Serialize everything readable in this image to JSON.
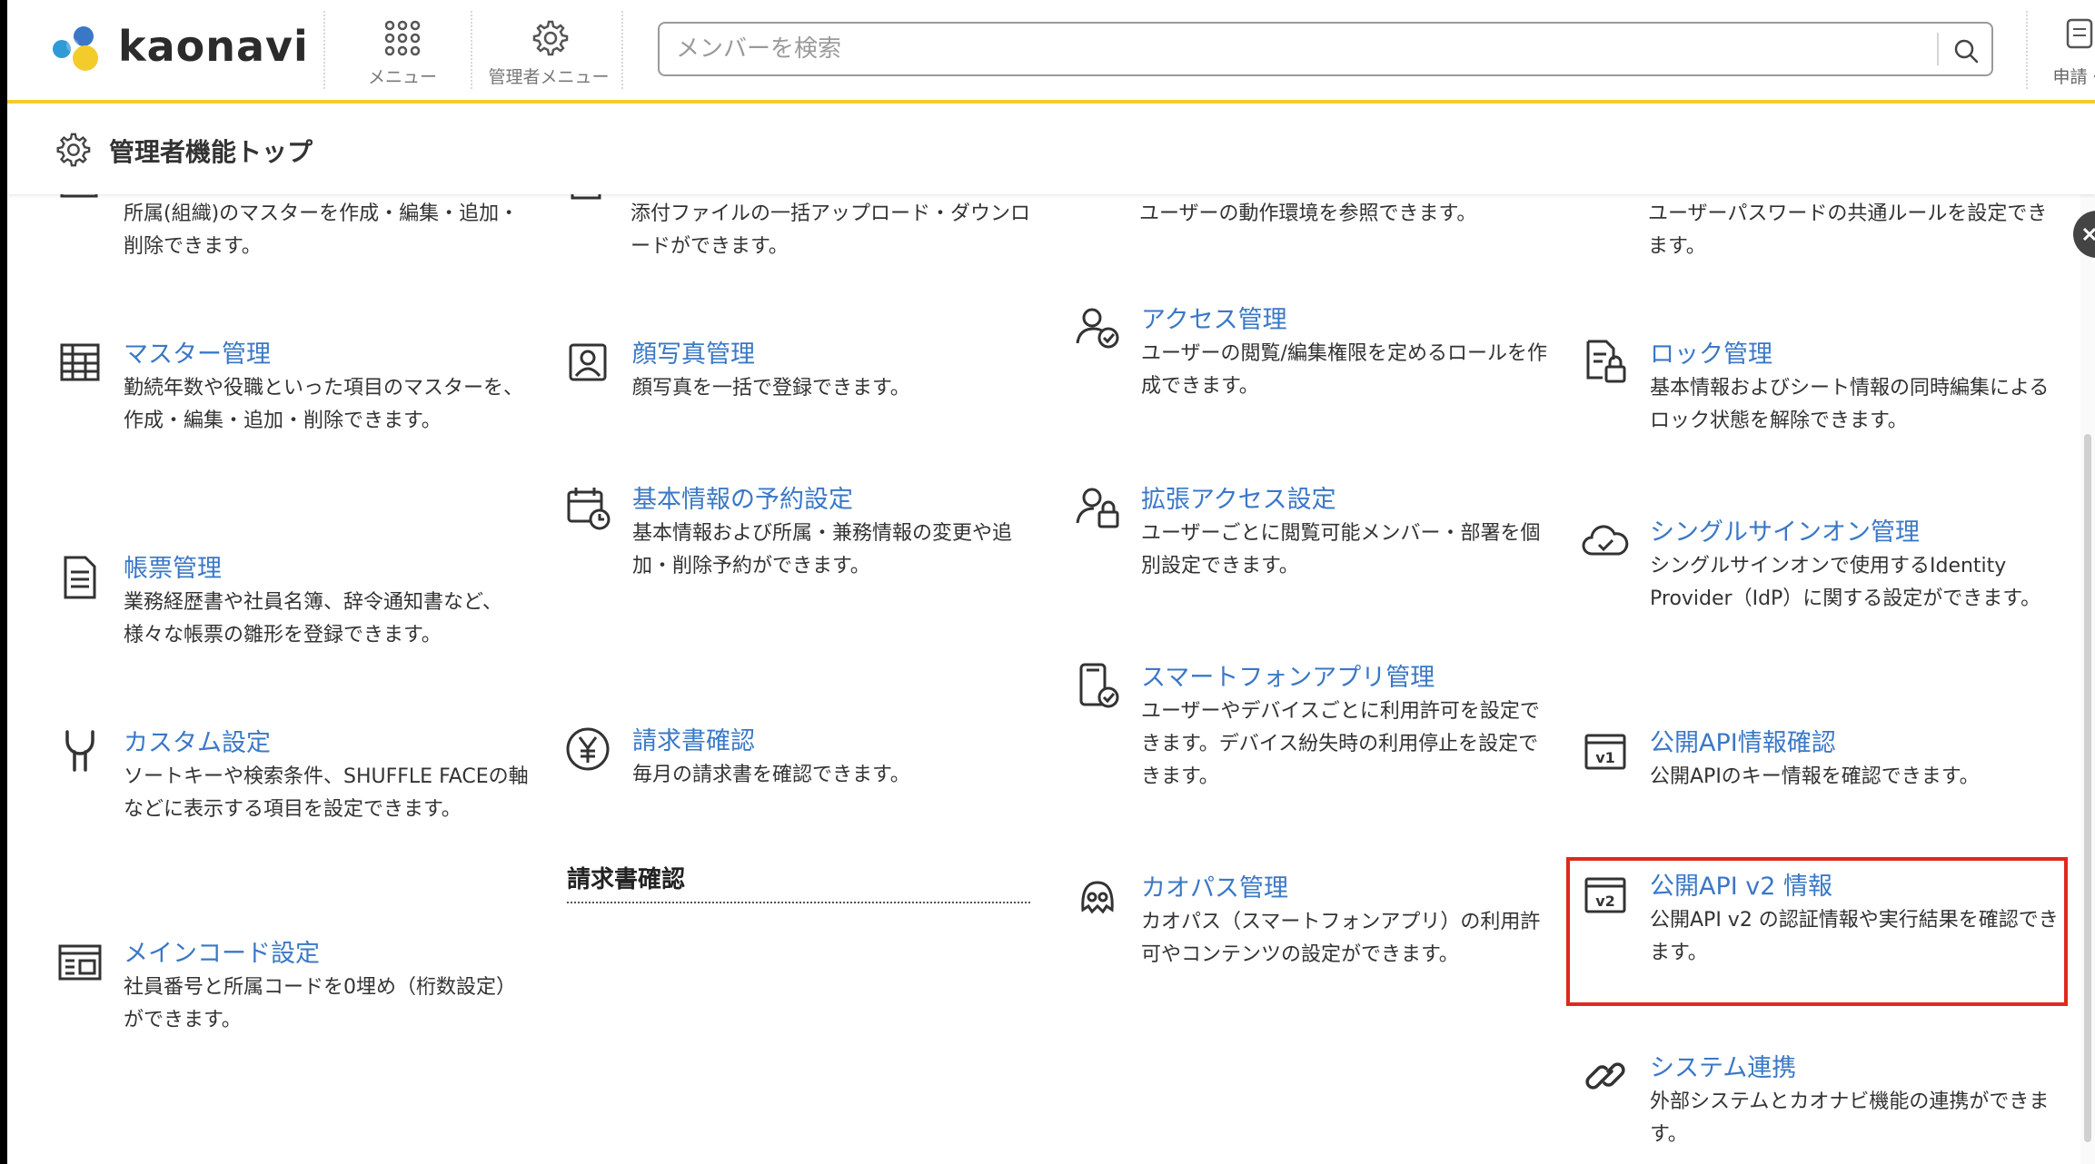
{
  "header": {
    "logo_text": "kaonavi",
    "menu_label": "メニュー",
    "admin_menu_label": "管理者メニュー",
    "search_placeholder": "メンバーを検索",
    "request_label": "申請・"
  },
  "subheader": {
    "title": "管理者機能トップ"
  },
  "colors": {
    "link": "#3a78c7",
    "accent_bar": "#f3cc2c",
    "highlight_border": "#e0281c"
  },
  "partial_items": [
    {
      "desc": "所属(組織)のマスターを作成・編集・追加・削除できます。"
    },
    {
      "desc": "添付ファイルの一括アップロード・ダウンロードができます。"
    },
    {
      "desc": "ユーザーの動作環境を参照できます。"
    },
    {
      "desc": "ユーザーパスワードの共通ルールを設定できます。"
    }
  ],
  "items": [
    {
      "key": "master",
      "icon": "table-icon",
      "title": "マスター管理",
      "desc": "勤続年数や役職といった項目のマスターを、作成・編集・追加・削除できます。"
    },
    {
      "key": "forms",
      "icon": "document-icon",
      "title": "帳票管理",
      "desc": "業務経歴書や社員名簿、辞令通知書など、様々な帳票の雛形を登録できます。"
    },
    {
      "key": "custom",
      "icon": "wrench-icon",
      "title": "カスタム設定",
      "desc": "ソートキーや検索条件、SHUFFLE FACEの軸などに表示する項目を設定できます。"
    },
    {
      "key": "maincode",
      "icon": "code-list-icon",
      "title": "メインコード設定",
      "desc": "社員番号と所属コードを0埋め（桁数設定）ができます。"
    },
    {
      "key": "photo",
      "icon": "portrait-icon",
      "title": "顔写真管理",
      "desc": "顔写真を一括で登録できます。"
    },
    {
      "key": "reserve",
      "icon": "calendar-clock-icon",
      "title": "基本情報の予約設定",
      "desc": "基本情報および所属・兼務情報の変更や追加・削除予約ができます。"
    },
    {
      "key": "invoice",
      "icon": "yen-icon",
      "title": "請求書確認",
      "desc": "毎月の請求書を確認できます。"
    },
    {
      "key": "access",
      "icon": "user-check-icon",
      "title": "アクセス管理",
      "desc": "ユーザーの閲覧/編集権限を定めるロールを作成できます。"
    },
    {
      "key": "extaccess",
      "icon": "user-lock-icon",
      "title": "拡張アクセス設定",
      "desc": "ユーザーごとに閲覧可能メンバー・部署を個別設定できます。"
    },
    {
      "key": "smartphone",
      "icon": "smartphone-check-icon",
      "title": "スマートフォンアプリ管理",
      "desc": "ユーザーやデバイスごとに利用許可を設定できます。デバイス紛失時の利用停止を設定できます。"
    },
    {
      "key": "kaopass",
      "icon": "kaopass-icon",
      "title": "カオパス管理",
      "desc": "カオパス（スマートフォンアプリ）の利用許可やコンテンツの設定ができます。"
    },
    {
      "key": "lock",
      "icon": "document-lock-icon",
      "title": "ロック管理",
      "desc": "基本情報およびシート情報の同時編集によるロック状態を解除できます。"
    },
    {
      "key": "sso",
      "icon": "cloud-check-icon",
      "title": "シングルサインオン管理",
      "desc": "シングルサインオンで使用するIdentity Provider（IdP）に関する設定ができます。"
    },
    {
      "key": "api1",
      "icon": "api-v1-icon",
      "title": "公開API情報確認",
      "desc": "公開APIのキー情報を確認できます。"
    },
    {
      "key": "api2",
      "icon": "api-v2-icon",
      "title": "公開API v2 情報",
      "desc": "公開API v2 の認証情報や実行結果を確認できます。"
    },
    {
      "key": "system",
      "icon": "link-icon",
      "title": "システム連携",
      "desc": "外部システムとカオナビ機能の連携ができます。"
    }
  ],
  "section": {
    "invoice_heading": "請求書確認"
  }
}
